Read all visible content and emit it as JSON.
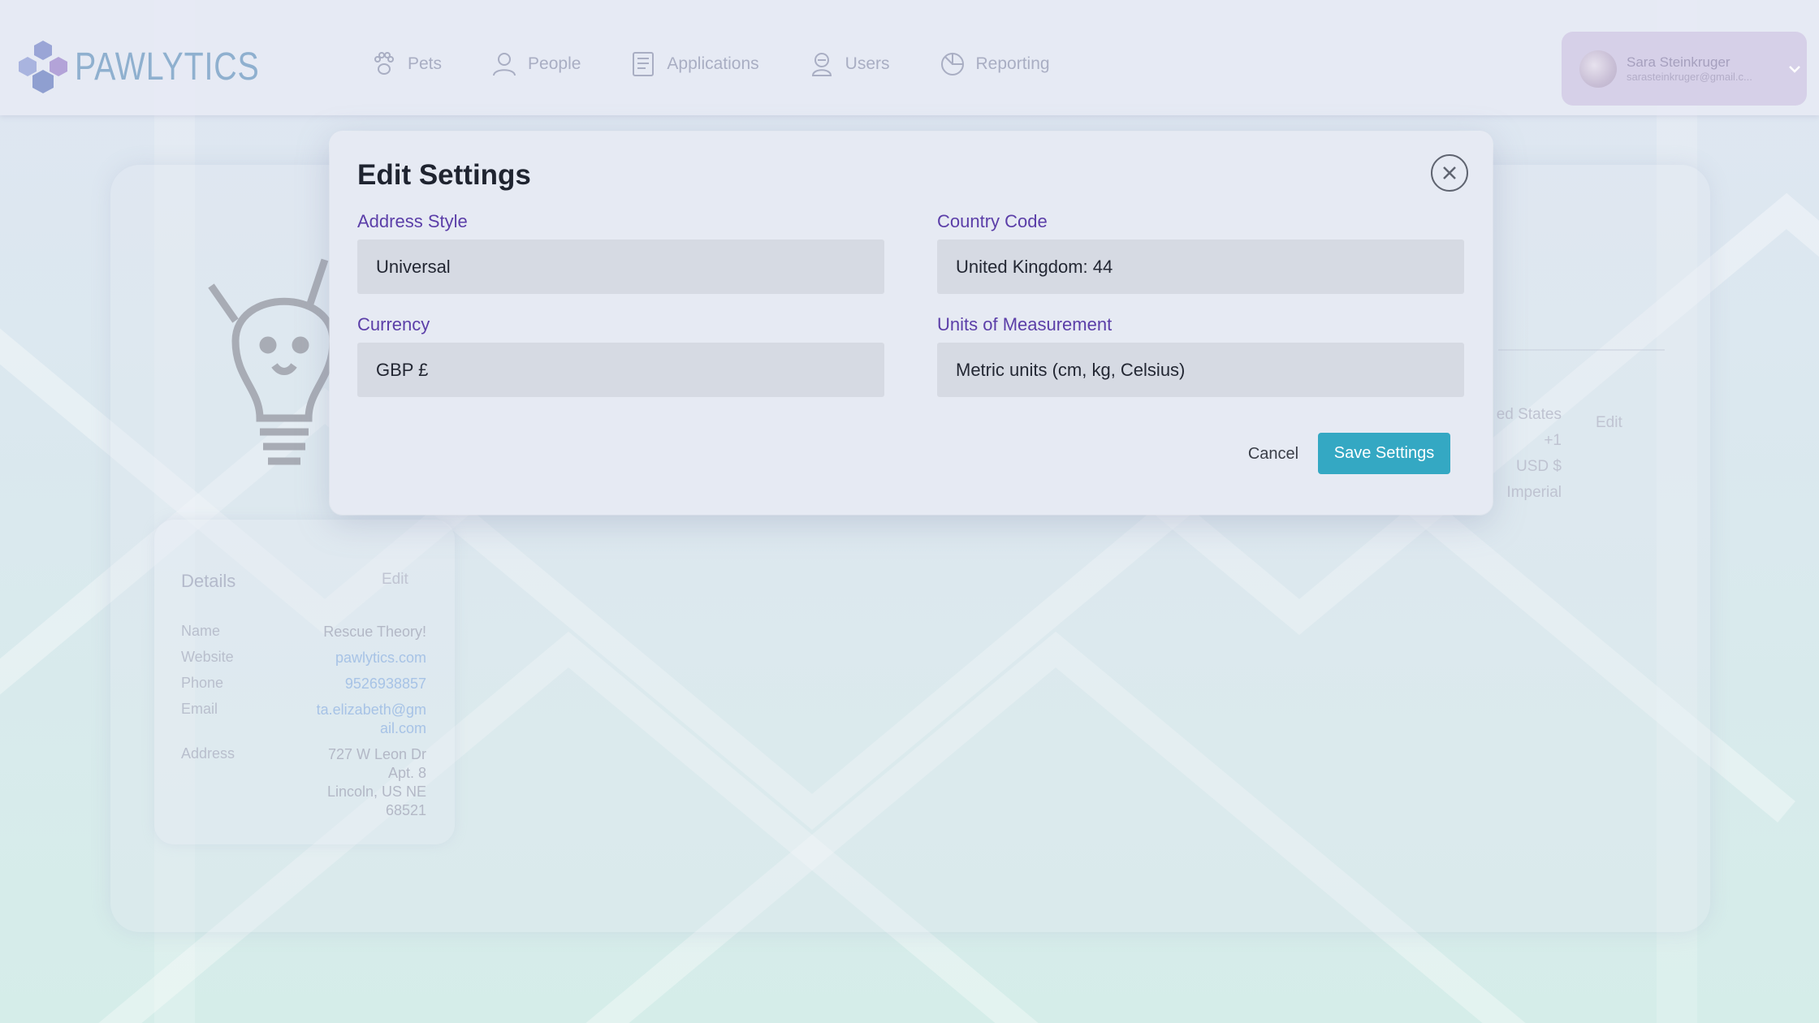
{
  "app": {
    "logo_text": "PAWLYTICS"
  },
  "nav": {
    "items": [
      {
        "label": "Pets",
        "icon": "paw-icon"
      },
      {
        "label": "People",
        "icon": "person-icon"
      },
      {
        "label": "Applications",
        "icon": "applications-icon"
      },
      {
        "label": "Users",
        "icon": "users-icon"
      },
      {
        "label": "Reporting",
        "icon": "reporting-icon"
      }
    ]
  },
  "user": {
    "name": "Sara Steinkruger",
    "email": "sarasteinkruger@gmail.c..."
  },
  "details": {
    "title": "Details",
    "edit_label": "Edit",
    "rows": [
      {
        "key": "Name",
        "value": "Rescue Theory!"
      },
      {
        "key": "Website",
        "value": "pawlytics.com"
      },
      {
        "key": "Phone",
        "value": "9526938857"
      },
      {
        "key": "Email",
        "value_line1": "ta.elizabeth@gm",
        "value_line2": "ail.com"
      },
      {
        "key": "Address",
        "value_line1": "727 W Leon Dr",
        "value_line2": "Apt. 8",
        "value_line3": "Lincoln, US NE",
        "value_line4": "68521"
      }
    ]
  },
  "settings_panel": {
    "country": "ed States",
    "code": "+1",
    "currency": "USD $",
    "units": "Imperial",
    "edit_label": "Edit"
  },
  "modal": {
    "title": "Edit Settings",
    "address_style": {
      "label": "Address Style",
      "value": "Universal"
    },
    "country_code": {
      "label": "Country Code",
      "value": "United Kingdom: 44"
    },
    "currency": {
      "label": "Currency",
      "value": "GBP £"
    },
    "units": {
      "label": "Units of Measurement",
      "value": "Metric units (cm, kg, Celsius)"
    },
    "cancel_label": "Cancel",
    "save_label": "Save Settings"
  },
  "colors": {
    "accent": "#34a8c3",
    "label_purple": "#5b3ea8",
    "field_bg": "#d6dae3",
    "modal_bg": "#e6eaf3"
  }
}
